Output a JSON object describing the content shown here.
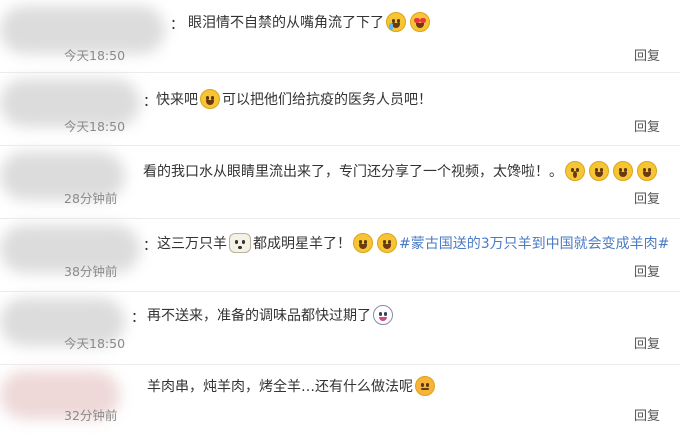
{
  "comments": [
    {
      "blur_tint": "gray",
      "colon": "：",
      "segments": [
        {
          "type": "text",
          "value": "眼泪情不自禁的从嘴角流了下了"
        },
        {
          "type": "emoji",
          "name": "crying-emoji"
        },
        {
          "type": "emoji",
          "name": "heart-eyes-emoji"
        }
      ],
      "time": "今天18:50",
      "reply": "回复"
    },
    {
      "blur_tint": "gray",
      "colon": "：",
      "segments": [
        {
          "type": "text",
          "value": "快来吧"
        },
        {
          "type": "emoji",
          "name": "laughing-emoji"
        },
        {
          "type": "text",
          "value": "可以把他们给抗疫的医务人员吧！"
        }
      ],
      "time": "今天18:50",
      "reply": "回复"
    },
    {
      "blur_tint": "gray",
      "colon": "",
      "segments": [
        {
          "type": "text",
          "value": "看的我口水从眼睛里流出来了，专门还分享了一个视频，太馋啦！。"
        },
        {
          "type": "emoji",
          "name": "scared-emoji"
        },
        {
          "type": "emoji",
          "name": "laughing-emoji"
        },
        {
          "type": "emoji",
          "name": "laughing-emoji"
        },
        {
          "type": "emoji",
          "name": "laughing-emoji"
        }
      ],
      "time": "28分钟前",
      "reply": "回复"
    },
    {
      "blur_tint": "gray",
      "colon": "：",
      "segments": [
        {
          "type": "text",
          "value": "这三万只羊"
        },
        {
          "type": "emoji",
          "name": "sheep-emoji"
        },
        {
          "type": "text",
          "value": "都成明星羊了！"
        },
        {
          "type": "emoji",
          "name": "laughing-emoji"
        },
        {
          "type": "emoji",
          "name": "laughing-emoji"
        },
        {
          "type": "hashtag",
          "value": "#蒙古国送的3万只羊到中国就会变成羊肉#"
        }
      ],
      "time": "38分钟前",
      "reply": "回复"
    },
    {
      "blur_tint": "gray",
      "colon": "：",
      "segments": [
        {
          "type": "text",
          "value": "再不送来，准备的调味品都快过期了"
        },
        {
          "type": "emoji",
          "name": "cat-face-emoji"
        }
      ],
      "time": "今天18:50",
      "reply": "回复"
    },
    {
      "blur_tint": "pink",
      "colon": "",
      "segments": [
        {
          "type": "text",
          "value": "羊肉串，炖羊肉，烤全羊…还有什么做法呢"
        },
        {
          "type": "emoji",
          "name": "pouting-emoji"
        }
      ],
      "time": "32分钟前",
      "reply": "回复"
    }
  ],
  "colors": {
    "hashtag": "#4a7bc4",
    "meta_text": "#8a8a8a",
    "divider": "#ececec"
  }
}
